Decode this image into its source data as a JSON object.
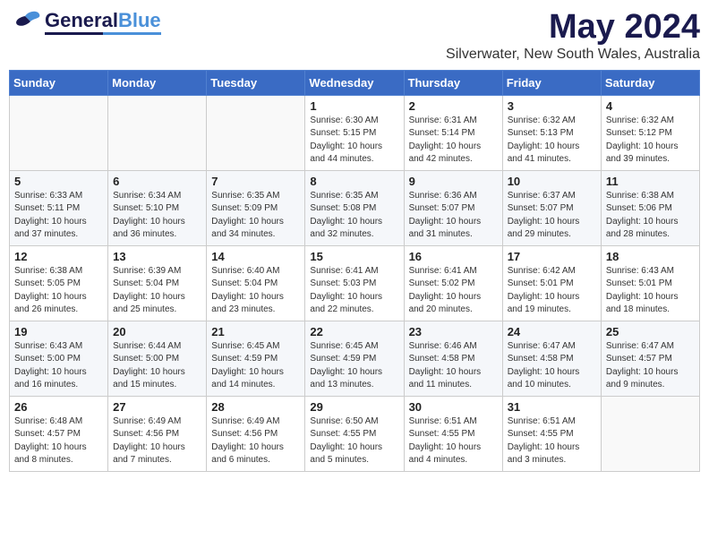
{
  "header": {
    "logo_general": "General",
    "logo_blue": "Blue",
    "main_title": "May 2024",
    "sub_title": "Silverwater, New South Wales, Australia"
  },
  "weekdays": [
    "Sunday",
    "Monday",
    "Tuesday",
    "Wednesday",
    "Thursday",
    "Friday",
    "Saturday"
  ],
  "weeks": [
    [
      {
        "day": "",
        "content": ""
      },
      {
        "day": "",
        "content": ""
      },
      {
        "day": "",
        "content": ""
      },
      {
        "day": "1",
        "content": "Sunrise: 6:30 AM\nSunset: 5:15 PM\nDaylight: 10 hours\nand 44 minutes."
      },
      {
        "day": "2",
        "content": "Sunrise: 6:31 AM\nSunset: 5:14 PM\nDaylight: 10 hours\nand 42 minutes."
      },
      {
        "day": "3",
        "content": "Sunrise: 6:32 AM\nSunset: 5:13 PM\nDaylight: 10 hours\nand 41 minutes."
      },
      {
        "day": "4",
        "content": "Sunrise: 6:32 AM\nSunset: 5:12 PM\nDaylight: 10 hours\nand 39 minutes."
      }
    ],
    [
      {
        "day": "5",
        "content": "Sunrise: 6:33 AM\nSunset: 5:11 PM\nDaylight: 10 hours\nand 37 minutes."
      },
      {
        "day": "6",
        "content": "Sunrise: 6:34 AM\nSunset: 5:10 PM\nDaylight: 10 hours\nand 36 minutes."
      },
      {
        "day": "7",
        "content": "Sunrise: 6:35 AM\nSunset: 5:09 PM\nDaylight: 10 hours\nand 34 minutes."
      },
      {
        "day": "8",
        "content": "Sunrise: 6:35 AM\nSunset: 5:08 PM\nDaylight: 10 hours\nand 32 minutes."
      },
      {
        "day": "9",
        "content": "Sunrise: 6:36 AM\nSunset: 5:07 PM\nDaylight: 10 hours\nand 31 minutes."
      },
      {
        "day": "10",
        "content": "Sunrise: 6:37 AM\nSunset: 5:07 PM\nDaylight: 10 hours\nand 29 minutes."
      },
      {
        "day": "11",
        "content": "Sunrise: 6:38 AM\nSunset: 5:06 PM\nDaylight: 10 hours\nand 28 minutes."
      }
    ],
    [
      {
        "day": "12",
        "content": "Sunrise: 6:38 AM\nSunset: 5:05 PM\nDaylight: 10 hours\nand 26 minutes."
      },
      {
        "day": "13",
        "content": "Sunrise: 6:39 AM\nSunset: 5:04 PM\nDaylight: 10 hours\nand 25 minutes."
      },
      {
        "day": "14",
        "content": "Sunrise: 6:40 AM\nSunset: 5:04 PM\nDaylight: 10 hours\nand 23 minutes."
      },
      {
        "day": "15",
        "content": "Sunrise: 6:41 AM\nSunset: 5:03 PM\nDaylight: 10 hours\nand 22 minutes."
      },
      {
        "day": "16",
        "content": "Sunrise: 6:41 AM\nSunset: 5:02 PM\nDaylight: 10 hours\nand 20 minutes."
      },
      {
        "day": "17",
        "content": "Sunrise: 6:42 AM\nSunset: 5:01 PM\nDaylight: 10 hours\nand 19 minutes."
      },
      {
        "day": "18",
        "content": "Sunrise: 6:43 AM\nSunset: 5:01 PM\nDaylight: 10 hours\nand 18 minutes."
      }
    ],
    [
      {
        "day": "19",
        "content": "Sunrise: 6:43 AM\nSunset: 5:00 PM\nDaylight: 10 hours\nand 16 minutes."
      },
      {
        "day": "20",
        "content": "Sunrise: 6:44 AM\nSunset: 5:00 PM\nDaylight: 10 hours\nand 15 minutes."
      },
      {
        "day": "21",
        "content": "Sunrise: 6:45 AM\nSunset: 4:59 PM\nDaylight: 10 hours\nand 14 minutes."
      },
      {
        "day": "22",
        "content": "Sunrise: 6:45 AM\nSunset: 4:59 PM\nDaylight: 10 hours\nand 13 minutes."
      },
      {
        "day": "23",
        "content": "Sunrise: 6:46 AM\nSunset: 4:58 PM\nDaylight: 10 hours\nand 11 minutes."
      },
      {
        "day": "24",
        "content": "Sunrise: 6:47 AM\nSunset: 4:58 PM\nDaylight: 10 hours\nand 10 minutes."
      },
      {
        "day": "25",
        "content": "Sunrise: 6:47 AM\nSunset: 4:57 PM\nDaylight: 10 hours\nand 9 minutes."
      }
    ],
    [
      {
        "day": "26",
        "content": "Sunrise: 6:48 AM\nSunset: 4:57 PM\nDaylight: 10 hours\nand 8 minutes."
      },
      {
        "day": "27",
        "content": "Sunrise: 6:49 AM\nSunset: 4:56 PM\nDaylight: 10 hours\nand 7 minutes."
      },
      {
        "day": "28",
        "content": "Sunrise: 6:49 AM\nSunset: 4:56 PM\nDaylight: 10 hours\nand 6 minutes."
      },
      {
        "day": "29",
        "content": "Sunrise: 6:50 AM\nSunset: 4:55 PM\nDaylight: 10 hours\nand 5 minutes."
      },
      {
        "day": "30",
        "content": "Sunrise: 6:51 AM\nSunset: 4:55 PM\nDaylight: 10 hours\nand 4 minutes."
      },
      {
        "day": "31",
        "content": "Sunrise: 6:51 AM\nSunset: 4:55 PM\nDaylight: 10 hours\nand 3 minutes."
      },
      {
        "day": "",
        "content": ""
      }
    ]
  ]
}
